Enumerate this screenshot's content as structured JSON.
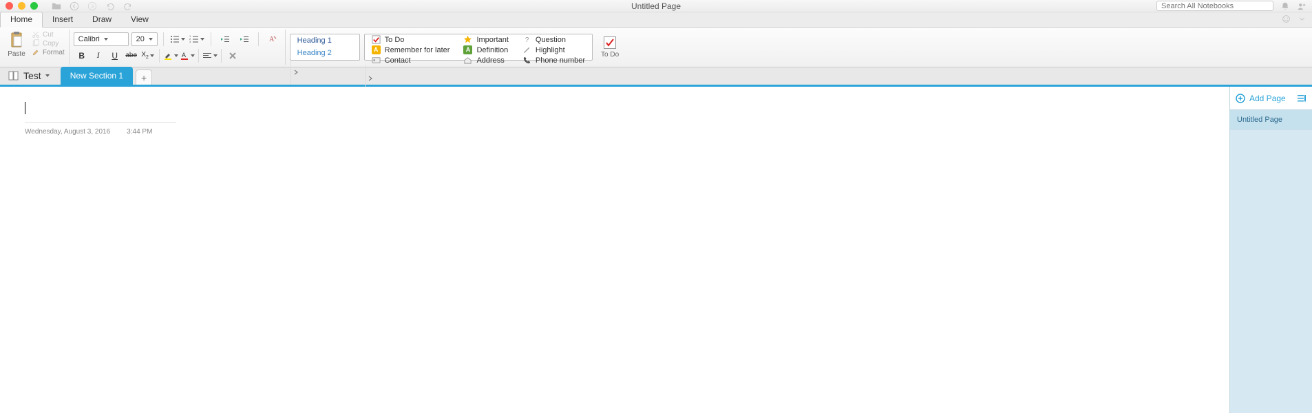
{
  "window": {
    "title": "Untitled Page",
    "search_placeholder": "Search All Notebooks"
  },
  "menutabs": {
    "items": [
      "Home",
      "Insert",
      "Draw",
      "View"
    ],
    "active_index": 0
  },
  "ribbon": {
    "paste_label": "Paste",
    "cut_label": "Cut",
    "copy_label": "Copy",
    "format_label": "Format",
    "font_name": "Calibri",
    "font_size": "20",
    "styles": {
      "heading1": "Heading 1",
      "heading2": "Heading 2"
    },
    "tags": {
      "col1": [
        {
          "icon": "todo",
          "label": "To Do"
        },
        {
          "icon": "remember",
          "label": "Remember for later"
        },
        {
          "icon": "contact",
          "label": "Contact"
        }
      ],
      "col2": [
        {
          "icon": "star",
          "label": "Important"
        },
        {
          "icon": "definition",
          "label": "Definition"
        },
        {
          "icon": "address",
          "label": "Address"
        }
      ],
      "col3": [
        {
          "icon": "question",
          "label": "Question"
        },
        {
          "icon": "highlight",
          "label": "Highlight"
        },
        {
          "icon": "phone",
          "label": "Phone number"
        }
      ]
    },
    "todo_label": "To Do"
  },
  "notebook": {
    "name": "Test",
    "section": "New Section 1"
  },
  "page": {
    "date": "Wednesday, August 3, 2016",
    "time": "3:44 PM"
  },
  "sidepanel": {
    "add_page_label": "Add Page",
    "pages": [
      "Untitled Page"
    ]
  }
}
